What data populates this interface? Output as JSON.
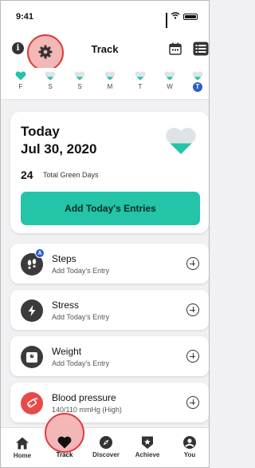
{
  "status": {
    "time": "9:41"
  },
  "header": {
    "title": "Track"
  },
  "week": [
    {
      "day": "F",
      "state": "full"
    },
    {
      "day": "S",
      "state": "half"
    },
    {
      "day": "S",
      "state": "half"
    },
    {
      "day": "M",
      "state": "half"
    },
    {
      "day": "T",
      "state": "half"
    },
    {
      "day": "W",
      "state": "half"
    },
    {
      "day": "T",
      "state": "today"
    }
  ],
  "today_card": {
    "title": "Today",
    "date": "Jul 30, 2020",
    "green_days_count": "24",
    "green_days_label": "Total Green Days",
    "add_button": "Add Today's Entries"
  },
  "entries": [
    {
      "name": "Steps",
      "sub": "Add Today's Entry",
      "icon": "footsteps-icon",
      "badge": "A"
    },
    {
      "name": "Stress",
      "sub": "Add Today's Entry",
      "icon": "lightning-icon"
    },
    {
      "name": "Weight",
      "sub": "Add Today's Entry",
      "icon": "weight-icon"
    },
    {
      "name": "Blood pressure",
      "sub": "140/110 mmHg (High)",
      "icon": "blood-pressure-icon"
    }
  ],
  "tabs": [
    {
      "label": "Home",
      "icon": "home-icon"
    },
    {
      "label": "Track",
      "icon": "heart-icon",
      "active": true
    },
    {
      "label": "Discover",
      "icon": "compass-icon"
    },
    {
      "label": "Achieve",
      "icon": "badge-star-icon"
    },
    {
      "label": "You",
      "icon": "person-icon"
    }
  ],
  "colors": {
    "accent": "#23C4A8",
    "highlight": "#E03A3A",
    "today_badge": "#2B5EC7"
  }
}
